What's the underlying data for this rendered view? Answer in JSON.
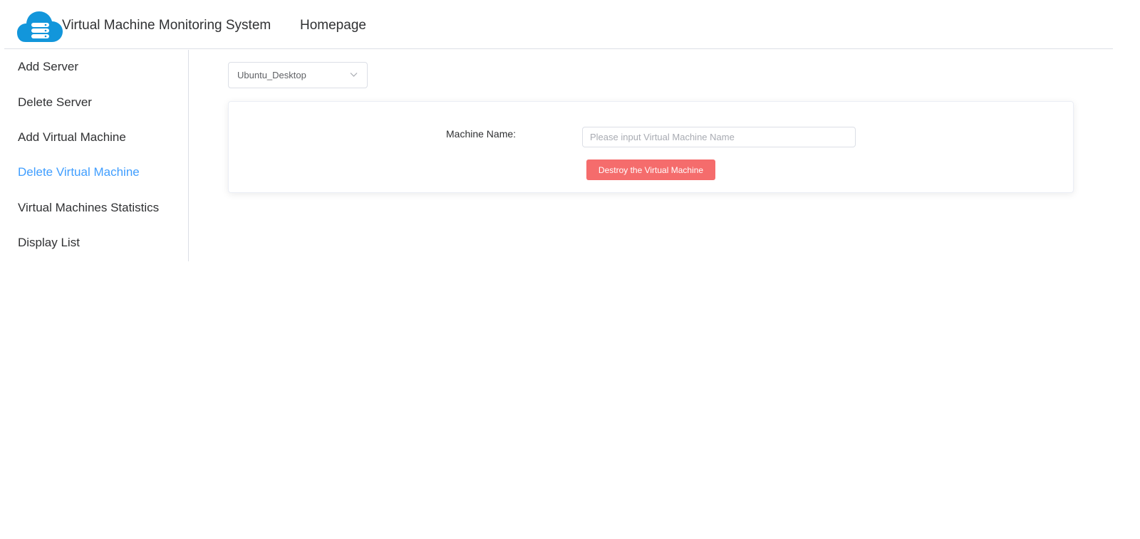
{
  "header": {
    "title": "Virtual Machine Monitoring System",
    "nav_home": "Homepage",
    "logo_icon": "cloud-server-icon",
    "accent_color": "#1296db"
  },
  "sidebar": {
    "items": [
      {
        "label": "Add Server",
        "active": false
      },
      {
        "label": "Delete Server",
        "active": false
      },
      {
        "label": "Add Virtual Machine",
        "active": false
      },
      {
        "label": "Delete Virtual Machine",
        "active": true
      },
      {
        "label": "Virtual Machines Statistics",
        "active": false
      },
      {
        "label": "Display List",
        "active": false
      }
    ],
    "active_color": "#409eff"
  },
  "server_select": {
    "value": "Ubuntu_Desktop",
    "icon": "chevron-down-icon"
  },
  "form": {
    "label": "Machine Name:",
    "input_value": "",
    "input_placeholder": "Please input Virtual Machine Name",
    "submit_label": "Destroy the Virtual Machine",
    "submit_color": "#f56c6c"
  }
}
